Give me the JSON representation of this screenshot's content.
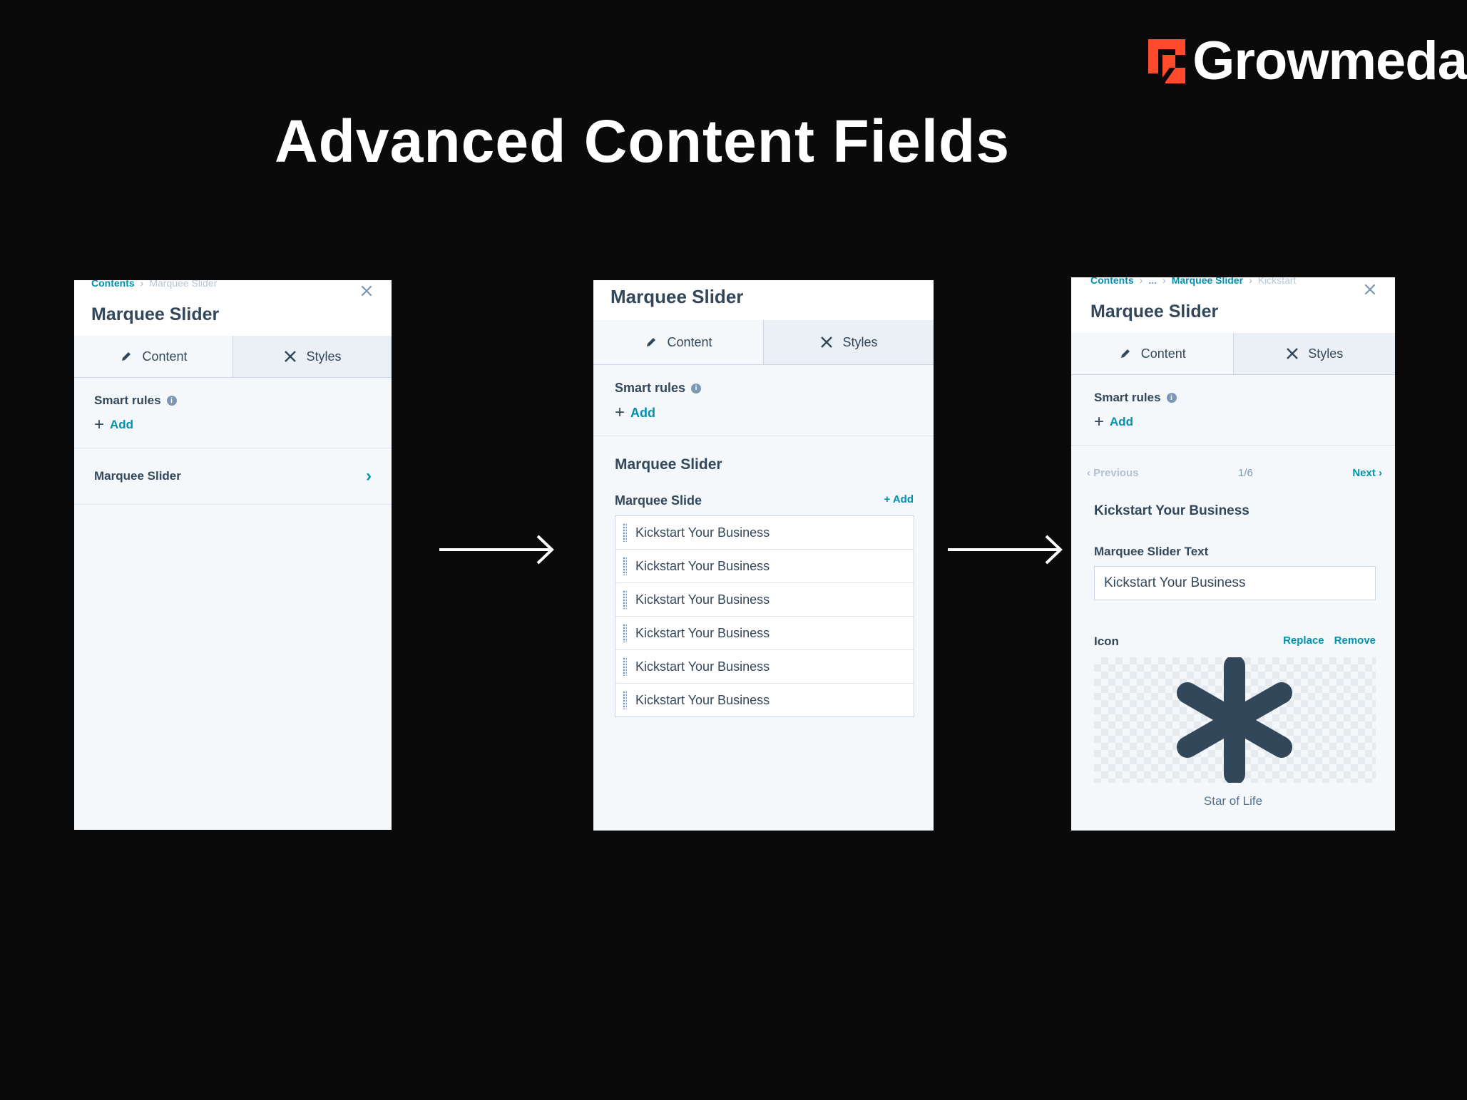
{
  "brand": {
    "name": "Growmeda",
    "color": "#ff4b2b"
  },
  "slide_title": "Advanced Content Fields",
  "panel1": {
    "breadcrumb": [
      "Contents",
      "Marquee Slider"
    ],
    "title": "Marquee Slider",
    "tabs": [
      "Content",
      "Styles"
    ],
    "smart_rules": "Smart rules",
    "add": "Add",
    "item": "Marquee Slider"
  },
  "panel2": {
    "title": "Marquee Slider",
    "tabs": [
      "Content",
      "Styles"
    ],
    "smart_rules": "Smart rules",
    "add": "Add",
    "section": "Marquee Slider",
    "field_label": "Marquee Slide",
    "field_add": "+ Add",
    "slides": [
      "Kickstart Your Business",
      "Kickstart Your Business",
      "Kickstart Your Business",
      "Kickstart Your Business",
      "Kickstart Your Business",
      "Kickstart Your Business"
    ]
  },
  "panel3": {
    "breadcrumb": [
      "Contents",
      "...",
      "Marquee Slider",
      "Kickstart"
    ],
    "title": "Marquee Slider",
    "tabs": [
      "Content",
      "Styles"
    ],
    "smart_rules": "Smart rules",
    "add": "Add",
    "pager": {
      "prev": "Previous",
      "count": "1/6",
      "next": "Next"
    },
    "item_title": "Kickstart Your Business",
    "text_label": "Marquee Slider Text",
    "text_value": "Kickstart Your Business",
    "icon_label": "Icon",
    "replace": "Replace",
    "remove": "Remove",
    "icon_name": "Star of Life"
  },
  "colors": {
    "accent": "#0091ae",
    "text": "#33475b",
    "icon": "#33475b"
  }
}
